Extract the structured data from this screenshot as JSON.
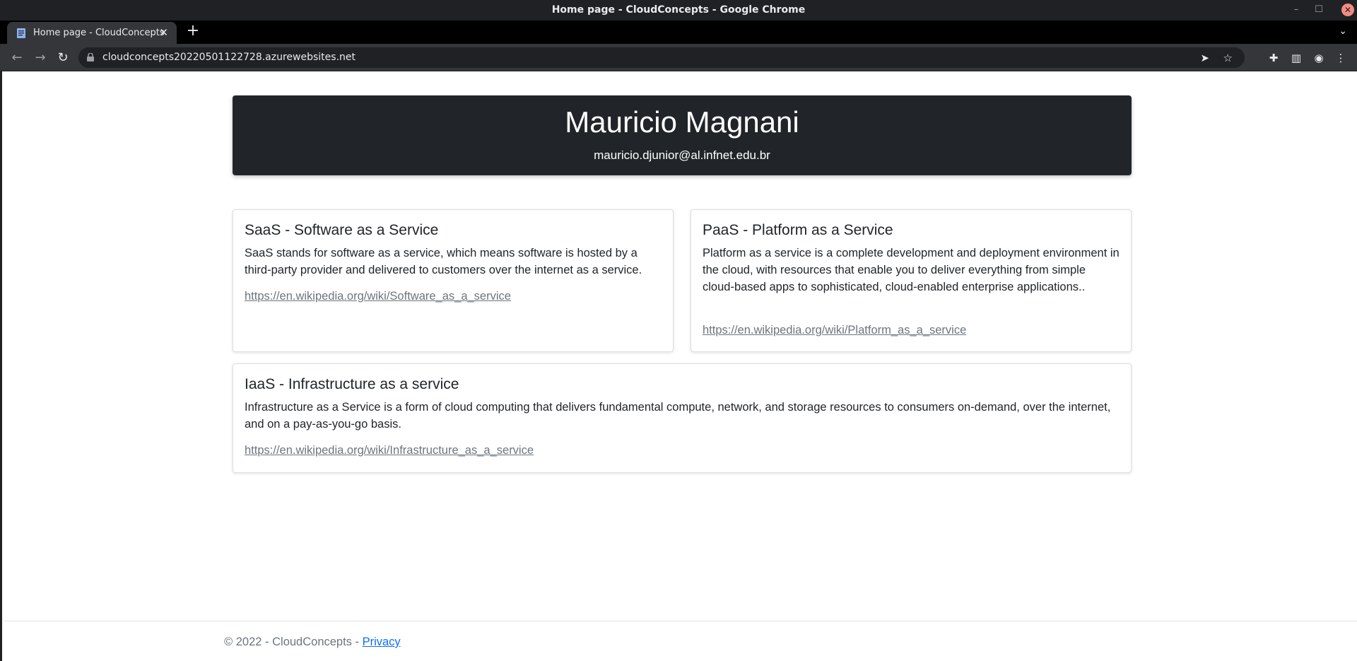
{
  "window": {
    "title": "Home page - CloudConcepts - Google Chrome"
  },
  "tab": {
    "title": "Home page - CloudConcepts"
  },
  "address_bar": {
    "url": "cloudconcepts20220501122728.azurewebsites.net"
  },
  "header": {
    "name": "Mauricio Magnani",
    "email": "mauricio.djunior@al.infnet.edu.br"
  },
  "cards": [
    {
      "title": "SaaS - Software as a Service",
      "text": "SaaS stands for software as a service, which means software is hosted by a third-party provider and delivered to customers over the internet as a service.",
      "link": "https://en.wikipedia.org/wiki/Software_as_a_service"
    },
    {
      "title": "PaaS - Platform as a Service",
      "text": "Platform as a service is a complete development and deployment environment in the cloud, with resources that enable you to deliver everything from simple cloud-based apps to sophisticated, cloud-enabled enterprise applications..",
      "link": "https://en.wikipedia.org/wiki/Platform_as_a_service"
    },
    {
      "title": "IaaS - Infrastructure as a service",
      "text": "Infrastructure as a Service is a form of cloud computing that delivers fundamental compute, network, and storage resources to consumers on-demand, over the internet, and on a pay-as-you-go basis.",
      "link": "https://en.wikipedia.org/wiki/Infrastructure_as_a_service"
    }
  ],
  "footer": {
    "copyright": "© 2022 - CloudConcepts - ",
    "privacy_link": "Privacy"
  },
  "colors": {
    "header_bg": "#212529",
    "link_muted": "#6c757d",
    "privacy_link": "#0d6efd"
  }
}
